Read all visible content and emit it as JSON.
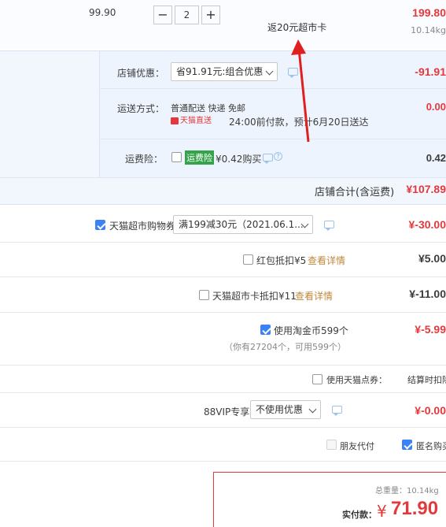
{
  "item": {
    "unit_price": "99.90",
    "qty": "2",
    "rebate_note": "返20元超市卡",
    "subtotal": "199.80",
    "weight": "10.14kg"
  },
  "shop": {
    "discount_label": "店铺优惠：",
    "discount_select": "省91.91元:组合优惠",
    "discount_value": "-91.91",
    "shipping_label": "运送方式：",
    "shipping_methods": "普通配送 快递 免邮",
    "tmall_direct_badge": "天猫直送",
    "delivery_promise": "24:00前付款，预计6月20日送达",
    "shipping_value": "0.00",
    "insurance_label": "运费险：",
    "insurance_badge": "运费险",
    "insurance_price": "¥0.42购买",
    "insurance_value": "0.42",
    "total_label": "店铺合计(含运费)",
    "total_value": "¥107.89"
  },
  "coupons": {
    "voucher_label": "天猫超市购物券",
    "voucher_select": "满199减30元（2021.06.1...",
    "voucher_value": "¥-30.00",
    "redpacket_label": "红包抵扣¥5",
    "redpacket_link": "查看详情",
    "redpacket_value": "¥5.00",
    "card_label": "天猫超市卡抵扣¥11",
    "card_link": "查看详情",
    "card_value": "¥-11.00",
    "coins_label": "使用淘金币599个",
    "coins_note": "（你有27204个，可用599个）",
    "coins_value": "¥-5.99",
    "points_label": "使用天猫点券：",
    "points_note": "结算时扣除",
    "vip_label": "88VIP专享",
    "vip_select": "不使用优惠",
    "vip_value": "¥-0.00",
    "friend_pay_label": "朋友代付",
    "anonymous_label": "匿名购买"
  },
  "summary": {
    "weight_label": "总重量：",
    "weight_value": "10.14kg",
    "pay_label": "实付款：",
    "currency": "¥",
    "pay_value": "71.90"
  },
  "colors": {
    "accent_red": "#e4393c",
    "panel_bg": "#f2f7fe",
    "check_blue": "#3b82f6",
    "link_brown": "#c0883c"
  }
}
